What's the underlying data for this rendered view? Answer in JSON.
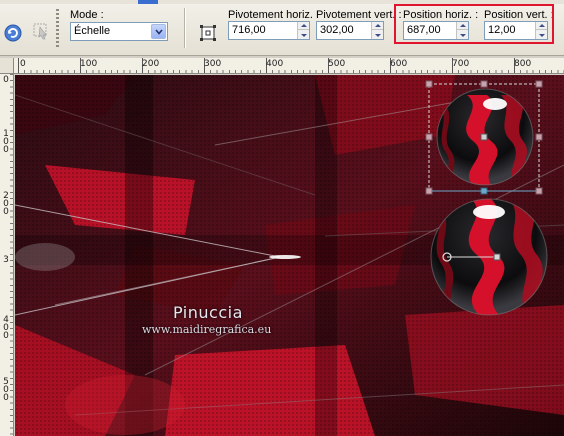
{
  "toolbar": {
    "mode_label": "Mode :",
    "mode_value": "Échelle",
    "pivot_h_label": "Pivotement horiz. :",
    "pivot_h_value": "716,00",
    "pivot_v_label": "Pivotement vert. :",
    "pivot_v_value": "302,00",
    "pos_h_label": "Position horiz. :",
    "pos_h_value": "687,00",
    "pos_v_label": "Position vert. :",
    "pos_v_value": "12,00"
  },
  "ruler": {
    "top_labels": [
      "0",
      "100",
      "200",
      "300",
      "400",
      "500",
      "600",
      "700",
      "800"
    ],
    "left_labels": [
      "0",
      "1\n0\n0",
      "2\n0\n0",
      "3",
      "4\n0\n0",
      "5\n0\n0"
    ]
  },
  "canvas": {
    "watermark_title": "Pinuccia",
    "watermark_url": "www.maidiregrafica.eu"
  },
  "colors": {
    "highlight": "#e0152f",
    "accent_red": "#c4122a",
    "background_dark": "#100508"
  }
}
